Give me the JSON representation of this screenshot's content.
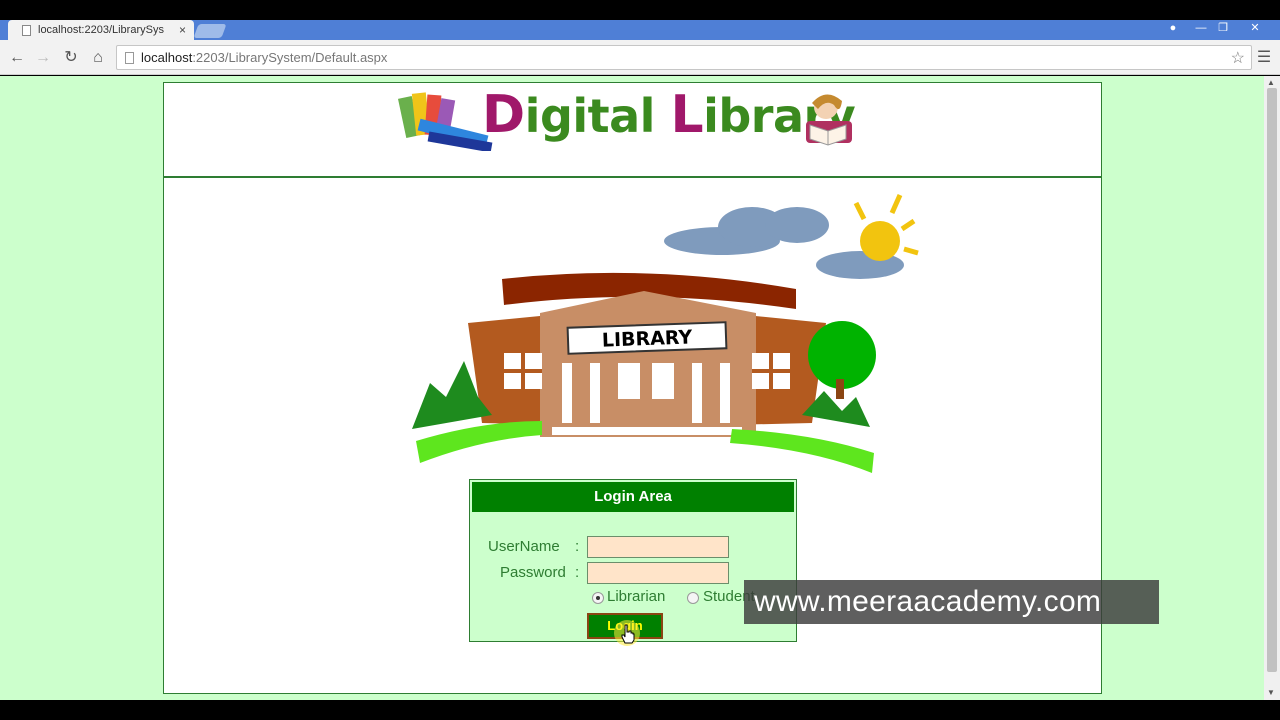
{
  "browser": {
    "tab_title": "localhost:2203/LibrarySys",
    "tab_close": "×",
    "url_host": "localhost",
    "url_rest": ":2203/LibrarySystem/Default.aspx",
    "icons": [
      "page-icon",
      "back-icon",
      "forward-icon",
      "reload-icon",
      "home-icon",
      "star-icon",
      "menu-icon",
      "user-icon",
      "minimize-icon",
      "restore-icon",
      "close-icon"
    ]
  },
  "header": {
    "logo_cap_d": "D",
    "logo_igital": "igital ",
    "logo_cap_l": "L",
    "logo_ibrary": "ibrary"
  },
  "illustration": {
    "building_sign": "LIBRARY"
  },
  "login": {
    "title": "Login Area",
    "username_label": "UserName",
    "password_label": "Password",
    "colon": ":",
    "username_value": "",
    "password_value": "",
    "role_options": [
      "Librarian",
      "Student"
    ],
    "selected_role": "Librarian",
    "button_label": "Login"
  },
  "watermark": "www.meeraacademy.com",
  "colors": {
    "page_background": "#ccffcc",
    "panel_header": "#008000",
    "button_text": "#ffff00",
    "input_background": "#ffe4c9",
    "logo_magenta": "#a0186a",
    "logo_green": "#3b8a1f"
  }
}
